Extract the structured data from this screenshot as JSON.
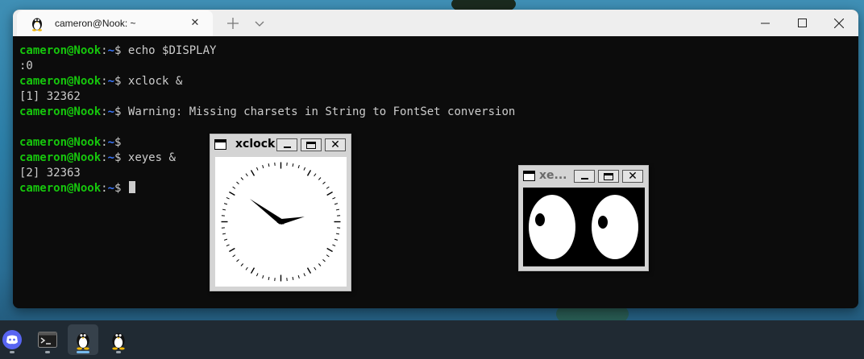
{
  "terminal": {
    "tab_title": "cameron@Nook: ~",
    "tab_icon": "tux-icon",
    "new_tab_icon": "plus-icon",
    "dropdown_icon": "chevron-down-icon",
    "lines": [
      {
        "user": "cameron@Nook",
        "sep": ":",
        "path": "~",
        "dollar": "$ ",
        "text": "echo $DISPLAY"
      },
      {
        "output": ":0"
      },
      {
        "user": "cameron@Nook",
        "sep": ":",
        "path": "~",
        "dollar": "$ ",
        "text": "xclock &"
      },
      {
        "output": "[1] 32362"
      },
      {
        "user": "cameron@Nook",
        "sep": ":",
        "path": "~",
        "dollar": "$ ",
        "text": "Warning: Missing charsets in String to FontSet conversion"
      },
      {
        "output": ""
      },
      {
        "user": "cameron@Nook",
        "sep": ":",
        "path": "~",
        "dollar": "$ ",
        "text": ""
      },
      {
        "user": "cameron@Nook",
        "sep": ":",
        "path": "~",
        "dollar": "$ ",
        "text": "xeyes &"
      },
      {
        "output": "[2] 32363"
      },
      {
        "user": "cameron@Nook",
        "sep": ":",
        "path": "~",
        "dollar": "$ ",
        "text": "",
        "cursor": true
      }
    ]
  },
  "xclock": {
    "title": "xclock",
    "time": {
      "hour": 10,
      "minute": 13
    }
  },
  "xeyes": {
    "title": "xe..."
  },
  "taskbar": {
    "apps": [
      {
        "name": "Discord",
        "icon": "discord-icon",
        "active": false
      },
      {
        "name": "Terminal",
        "icon": "terminal-icon",
        "active": false
      },
      {
        "name": "Ubuntu",
        "icon": "tux-icon",
        "active": true
      },
      {
        "name": "Linux",
        "icon": "tux-icon",
        "active": false
      }
    ]
  },
  "colors": {
    "prompt_user": "#16c60c",
    "prompt_path": "#3b78ff",
    "terminal_bg": "#0c0c0c",
    "terminal_fg": "#cccccc"
  }
}
